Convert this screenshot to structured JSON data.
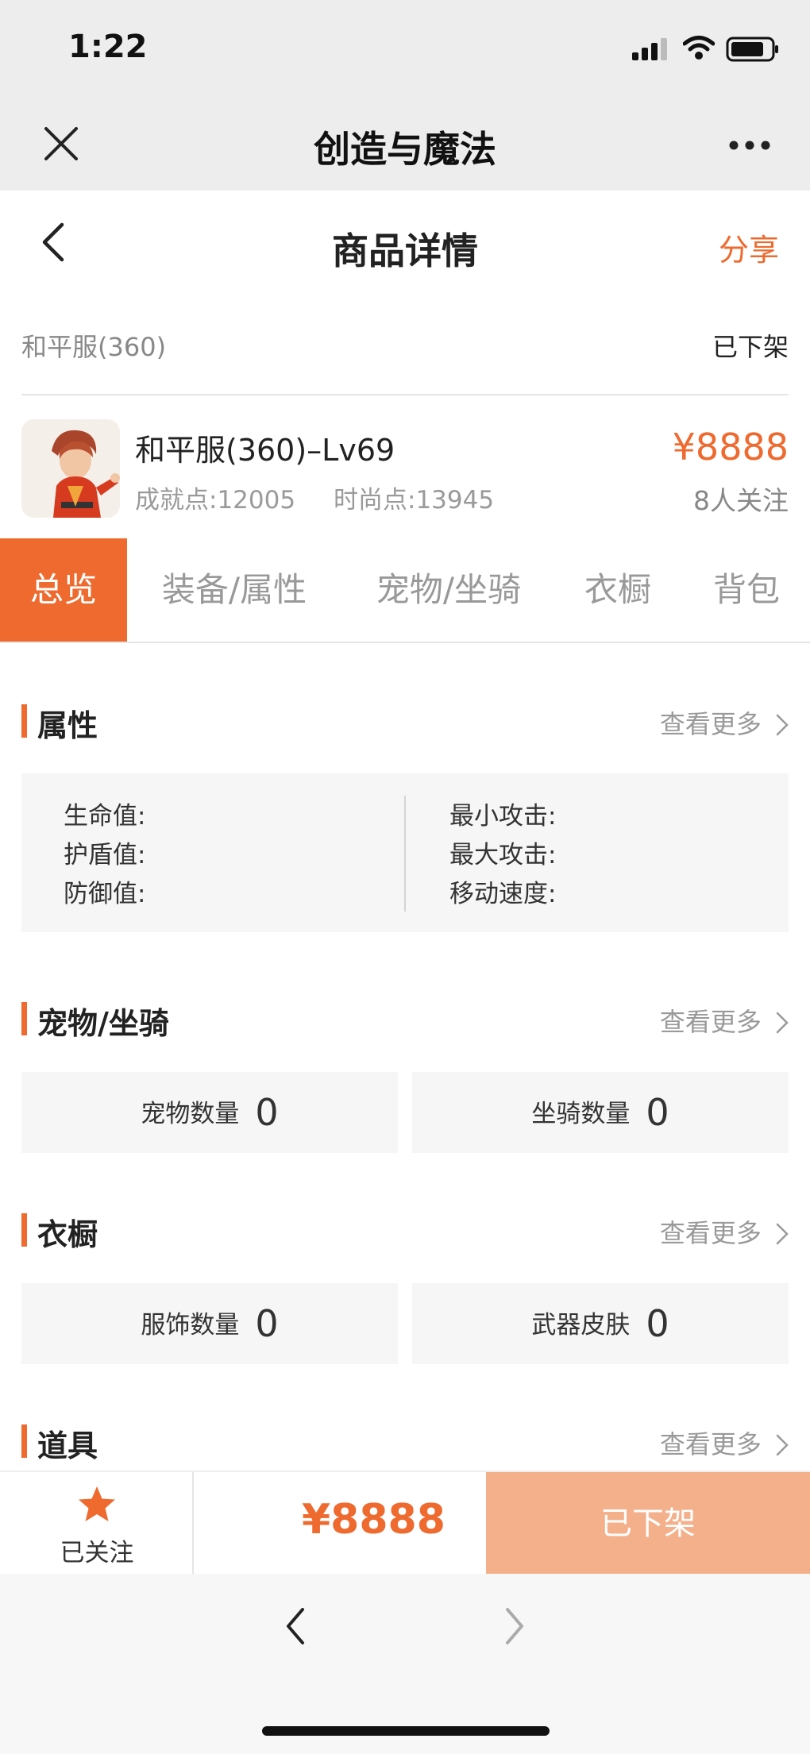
{
  "status_bar": {
    "time": "1:22"
  },
  "wechat_bar": {
    "title": "创造与魔法"
  },
  "nav": {
    "title": "商品详情",
    "share_label": "分享"
  },
  "server": {
    "name": "和平服(360)",
    "status": "已下架"
  },
  "product": {
    "title": "和平服(360)–Lv69",
    "achievement": "成就点:12005",
    "fashion": "时尚点:13945",
    "price": "¥8888",
    "followers": "8人关注"
  },
  "tabs": [
    {
      "label": "总览",
      "active": true
    },
    {
      "label": "装备/属性",
      "active": false
    },
    {
      "label": "宠物/坐骑",
      "active": false
    },
    {
      "label": "衣橱",
      "active": false
    },
    {
      "label": "背包",
      "active": false
    }
  ],
  "sections": {
    "attributes": {
      "title": "属性",
      "more": "查看更多",
      "left": [
        "生命值:",
        "护盾值:",
        "防御值:"
      ],
      "right": [
        "最小攻击:",
        "最大攻击:",
        "移动速度:"
      ]
    },
    "pets": {
      "title": "宠物/坐骑",
      "more": "查看更多",
      "cards": [
        {
          "label": "宠物数量",
          "value": "0"
        },
        {
          "label": "坐骑数量",
          "value": "0"
        }
      ]
    },
    "wardrobe": {
      "title": "衣橱",
      "more": "查看更多",
      "cards": [
        {
          "label": "服饰数量",
          "value": "0"
        },
        {
          "label": "武器皮肤",
          "value": "0"
        }
      ]
    },
    "items": {
      "title": "道具",
      "more": "查看更多"
    }
  },
  "bottom_bar": {
    "follow_label": "已关注",
    "price": "¥8888",
    "status_button": "已下架"
  },
  "colors": {
    "accent": "#ee6a2f",
    "disabled_button": "#f3b08b",
    "panel": "#f6f6f6"
  }
}
